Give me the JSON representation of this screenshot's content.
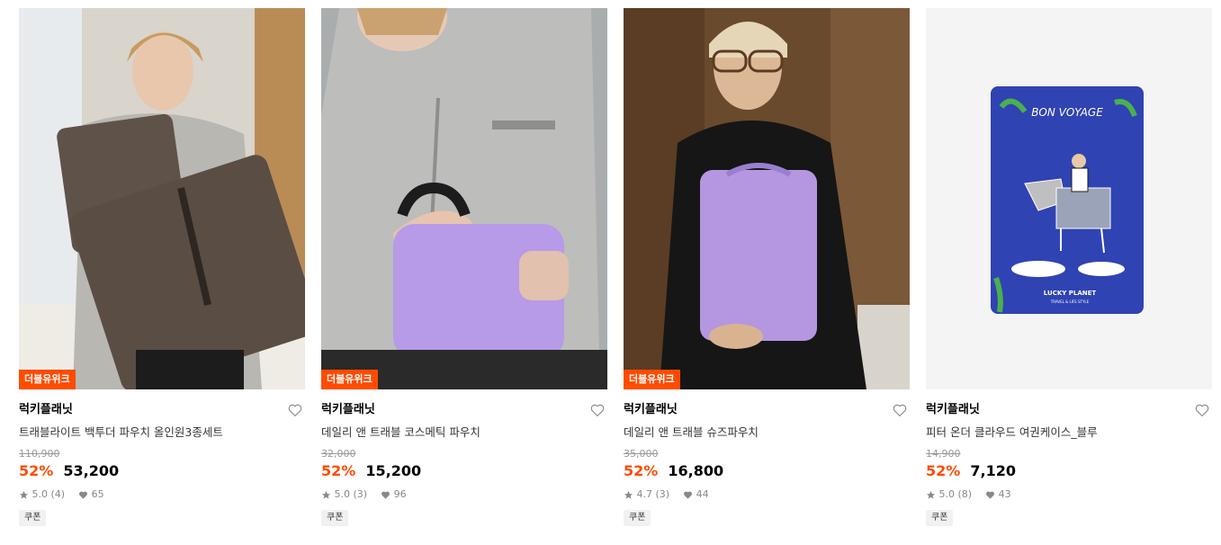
{
  "colors": {
    "accent": "#ff4b00",
    "muted": "#999999"
  },
  "icons": {
    "wishlist": "heart-outline-icon",
    "rating": "star-icon",
    "likes": "heart-filled-icon"
  },
  "products": [
    {
      "badge": "더블유위크",
      "brand": "럭키플래닛",
      "name": "트래블라이트 백투더 파우치 올인원3종세트",
      "original_price": "110,900",
      "discount": "52%",
      "price": "53,200",
      "rating": "5.0 (4)",
      "likes": "65",
      "coupon": "쿠폰"
    },
    {
      "badge": "더블유위크",
      "brand": "럭키플래닛",
      "name": "데일리 앤 트래블 코스메틱 파우치",
      "original_price": "32,000",
      "discount": "52%",
      "price": "15,200",
      "rating": "5.0 (3)",
      "likes": "96",
      "coupon": "쿠폰"
    },
    {
      "badge": "더블유위크",
      "brand": "럭키플래닛",
      "name": "데일리 앤 트래블 슈즈파우치",
      "original_price": "35,000",
      "discount": "52%",
      "price": "16,800",
      "rating": "4.7 (3)",
      "likes": "44",
      "coupon": "쿠폰"
    },
    {
      "brand": "럭키플래닛",
      "name": "피터 온더 클라우드 여권케이스_블루",
      "original_price": "14,900",
      "discount": "52%",
      "price": "7,120",
      "rating": "5.0 (8)",
      "likes": "43",
      "coupon": "쿠폰",
      "image_text": {
        "title": "BON VOYAGE",
        "logo": "LUCKY PLANET",
        "tagline": "TRAVEL & LIFE STYLE"
      }
    }
  ]
}
